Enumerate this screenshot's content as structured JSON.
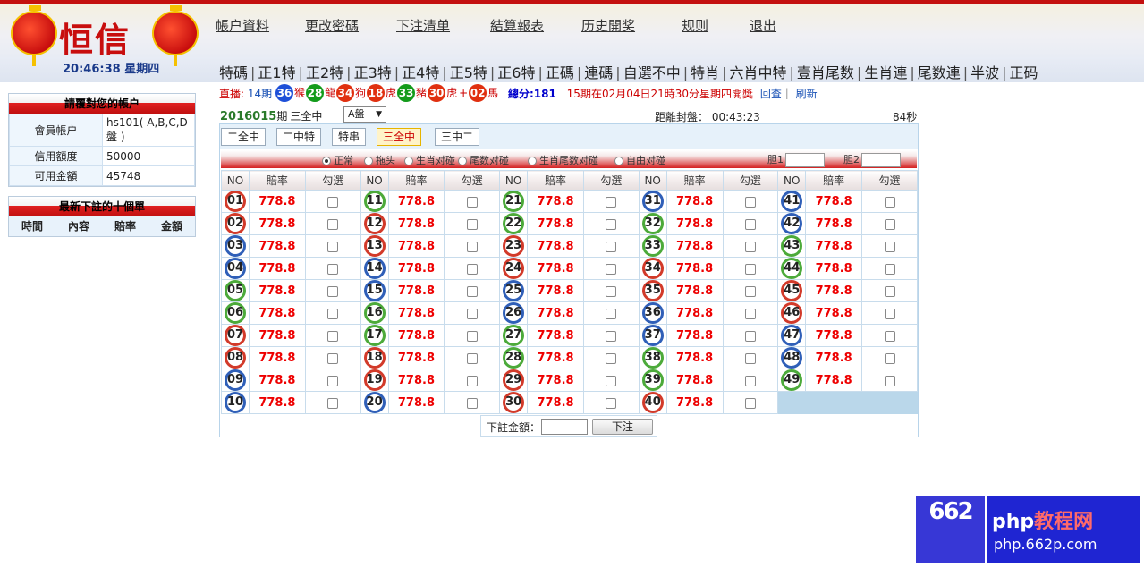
{
  "header": {
    "logo_text": "恒信",
    "clock": "20:46:38 星期四",
    "nav": [
      "帳户資料",
      "更改密碼",
      "下注清单",
      "結算報表",
      "历史開奖",
      "规则",
      "退出"
    ],
    "subnav": [
      "特碼",
      "正1特",
      "正2特",
      "正3特",
      "正4特",
      "正5特",
      "正6特",
      "正碼",
      "連碼",
      "自選不中",
      "特肖",
      "六肖中特",
      "壹肖尾数",
      "生肖連",
      "尾数連",
      "半波",
      "正码"
    ]
  },
  "account": {
    "title": "請覆對您的帳户",
    "rows": [
      {
        "k": "會員帳户",
        "v": "hs101( A,B,C,D盤 )"
      },
      {
        "k": "信用額度",
        "v": "50000"
      },
      {
        "k": "可用金額",
        "v": "45748"
      }
    ]
  },
  "latest": {
    "title": "最新下註的十個單",
    "cols": [
      "時間",
      "內容",
      "賠率",
      "金額"
    ]
  },
  "draw": {
    "live_label": "直播:",
    "period": "14期",
    "balls": [
      {
        "n": "36",
        "zodiac": "猴",
        "color": "blue"
      },
      {
        "n": "28",
        "zodiac": "龍",
        "color": "green"
      },
      {
        "n": "34",
        "zodiac": "狗",
        "color": "red"
      },
      {
        "n": "18",
        "zodiac": "虎",
        "color": "red"
      },
      {
        "n": "33",
        "zodiac": "豬",
        "color": "green"
      }
    ],
    "special": {
      "n": "30",
      "zodiac": "虎",
      "color": "red"
    },
    "extra": {
      "n": "02",
      "zodiac": "馬",
      "color": "red"
    },
    "plus": "+",
    "total_label": "總分:181",
    "next_info": "15期在02月04日21時30分星期四開獎",
    "replay": "回查",
    "refresh": "刷新"
  },
  "period": {
    "number": "2016015",
    "suffix": "期",
    "play": "三全中",
    "pan": "A盤",
    "close_label": "距離封盤：",
    "countdown": "00:43:23",
    "refresh_secs": "84秒"
  },
  "tabs": [
    "二全中",
    "二中特",
    "特串",
    "三全中",
    "三中二"
  ],
  "active_tab": 3,
  "options": [
    {
      "label": "正常",
      "checked": true
    },
    {
      "label": "拖头",
      "checked": false
    },
    {
      "label": "生肖对碰",
      "checked": false
    },
    {
      "label": "尾数对碰",
      "checked": false
    },
    {
      "label": "生肖尾数对碰",
      "checked": false
    },
    {
      "label": "自由对碰",
      "checked": false
    }
  ],
  "dan_labels": [
    "胆1",
    "胆2"
  ],
  "grid": {
    "headers": [
      "NO",
      "賠率",
      "勾選"
    ],
    "odds": "778.8",
    "ball_colors": {
      "red": [
        "01",
        "02",
        "07",
        "08",
        "12",
        "13",
        "18",
        "19",
        "23",
        "24",
        "29",
        "30",
        "34",
        "35",
        "40",
        "45",
        "46"
      ],
      "blue": [
        "03",
        "04",
        "09",
        "10",
        "14",
        "15",
        "20",
        "25",
        "26",
        "31",
        "36",
        "37",
        "41",
        "42",
        "47",
        "48"
      ],
      "green": [
        "05",
        "06",
        "11",
        "16",
        "17",
        "21",
        "22",
        "27",
        "28",
        "32",
        "33",
        "38",
        "39",
        "43",
        "44",
        "49"
      ]
    }
  },
  "bet": {
    "label": "下註金額：",
    "submit": "下注"
  },
  "watermark": {
    "mark": "662",
    "brand_a": "php",
    "brand_b": "教程网",
    "url": "php.662p.com"
  }
}
